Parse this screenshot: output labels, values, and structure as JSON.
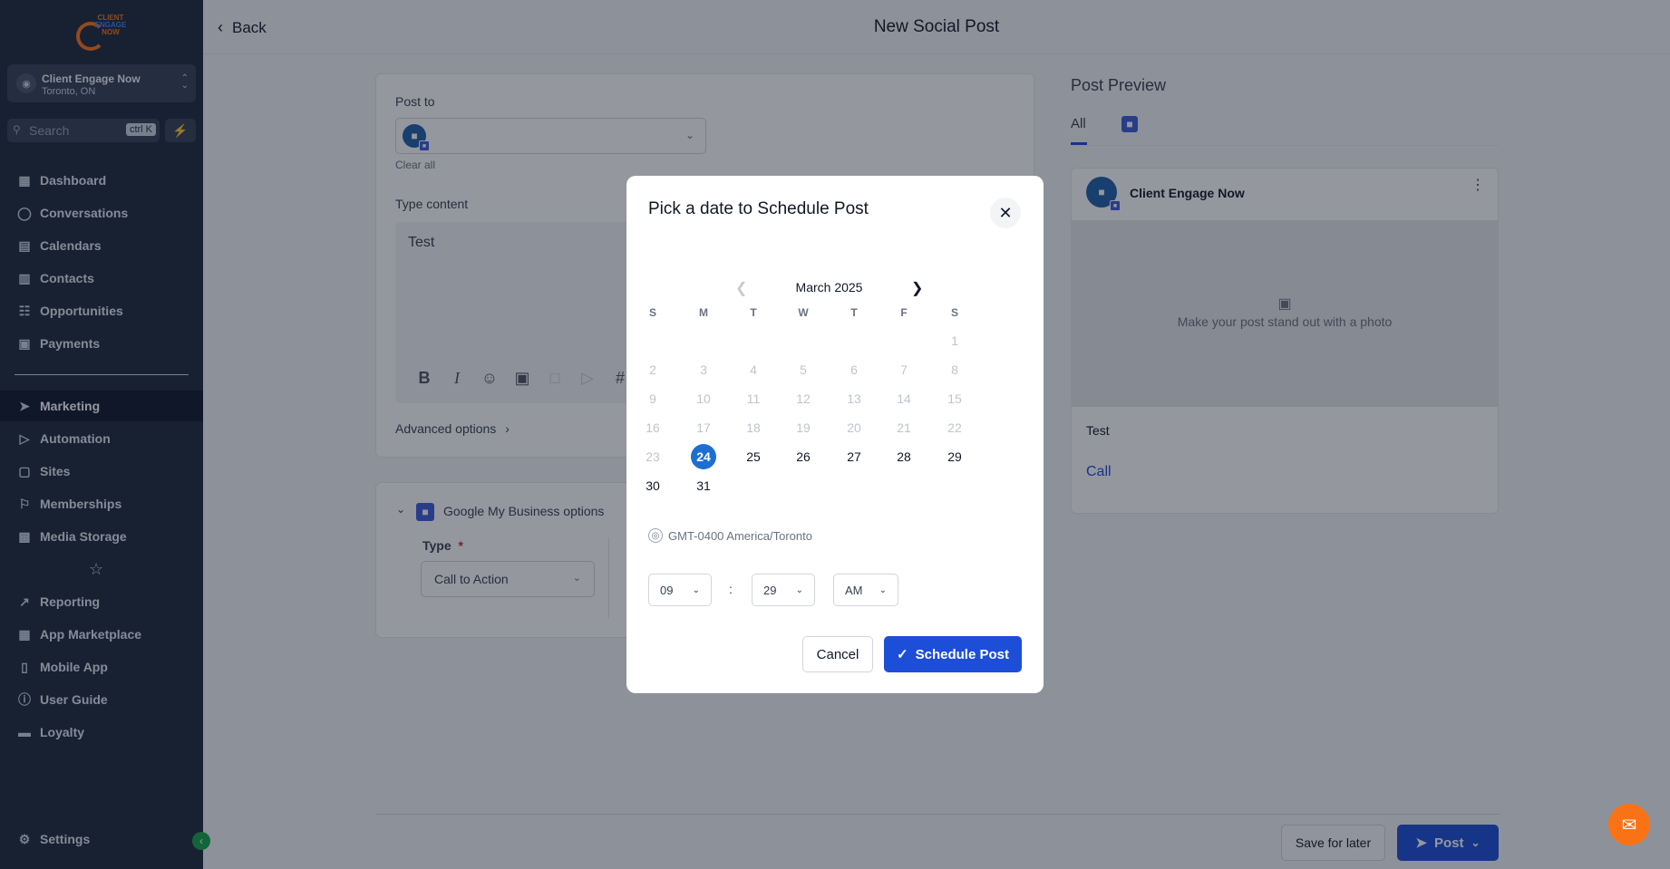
{
  "sidebar": {
    "logo": {
      "lines": [
        "CLIENT",
        "ENGAGE",
        "NOW"
      ]
    },
    "account": {
      "name": "Client Engage Now",
      "location": "Toronto, ON"
    },
    "search": {
      "placeholder": "Search",
      "shortcut": "ctrl K"
    },
    "items": [
      {
        "label": "Dashboard",
        "icon": "grid-icon"
      },
      {
        "label": "Conversations",
        "icon": "chat-icon"
      },
      {
        "label": "Calendars",
        "icon": "calendar-icon"
      },
      {
        "label": "Contacts",
        "icon": "contacts-icon"
      },
      {
        "label": "Opportunities",
        "icon": "opportunities-icon"
      },
      {
        "label": "Payments",
        "icon": "payments-icon"
      },
      {
        "label": "Marketing",
        "icon": "send-icon",
        "active": true
      },
      {
        "label": "Automation",
        "icon": "automation-icon"
      },
      {
        "label": "Sites",
        "icon": "sites-icon"
      },
      {
        "label": "Memberships",
        "icon": "memberships-icon"
      },
      {
        "label": "Media Storage",
        "icon": "image-icon"
      },
      {
        "label": "Reporting",
        "icon": "trend-icon"
      },
      {
        "label": "App Marketplace",
        "icon": "apps-icon"
      },
      {
        "label": "Mobile App",
        "icon": "mobile-icon"
      },
      {
        "label": "User Guide",
        "icon": "info-icon"
      },
      {
        "label": "Loyalty",
        "icon": "wallet-icon"
      }
    ],
    "settings": "Settings"
  },
  "header": {
    "back": "Back",
    "title": "New Social Post"
  },
  "composer": {
    "post_to_label": "Post to",
    "clear_all": "Clear all",
    "type_content_label": "Type content",
    "content": "Test",
    "advanced": "Advanced options",
    "gmb_options": "Google My Business options",
    "type_label": "Type",
    "required_mark": "*",
    "type_value": "Call to Action"
  },
  "preview": {
    "title": "Post Preview",
    "tab_all": "All",
    "account": "Client Engage Now",
    "photo_hint": "Make your post stand out with a photo",
    "text": "Test",
    "cta": "Call"
  },
  "footer": {
    "save_later": "Save for later",
    "post": "Post"
  },
  "modal": {
    "title": "Pick a date to Schedule Post",
    "month": "March 2025",
    "weekdays": [
      "S",
      "M",
      "T",
      "W",
      "T",
      "F",
      "S"
    ],
    "days": [
      "1",
      "2",
      "3",
      "4",
      "5",
      "6",
      "7",
      "8",
      "9",
      "10",
      "11",
      "12",
      "13",
      "14",
      "15",
      "16",
      "17",
      "18",
      "19",
      "20",
      "21",
      "22",
      "23",
      "24",
      "25",
      "26",
      "27",
      "28",
      "29",
      "30",
      "31"
    ],
    "selected_day": 24,
    "first_weekday": 6,
    "timezone": "GMT-0400 America/Toronto",
    "hour": "09",
    "separator": ":",
    "minute": "29",
    "ampm": "AM",
    "cancel": "Cancel",
    "schedule": "Schedule Post"
  },
  "colors": {
    "accent": "#1d4ed8",
    "sidebar": "#1e293b",
    "help": "#f97316",
    "selected": "#1d6fd1"
  }
}
